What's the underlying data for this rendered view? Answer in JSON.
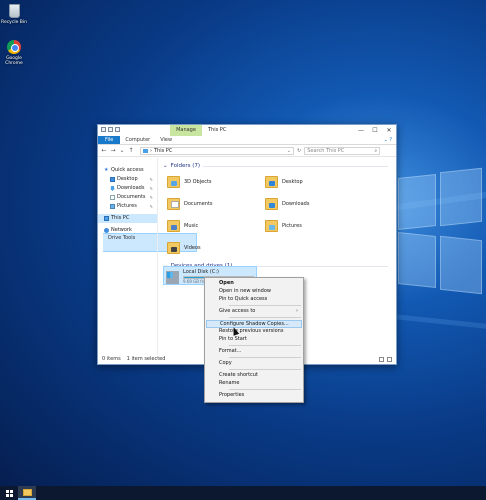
{
  "desktop": {
    "icons": [
      {
        "label": "Recycle Bin",
        "icon": "recycle-bin-icon"
      },
      {
        "label": "Google Chrome",
        "icon": "chrome-icon"
      }
    ]
  },
  "window": {
    "context_tab": "Manage",
    "title": "This PC",
    "controls": {
      "minimize": "—",
      "maximize": "☐",
      "close": "✕"
    },
    "ribbon_tabs": [
      "File",
      "Computer",
      "View",
      "Drive Tools"
    ],
    "address_path": "This PC",
    "search_placeholder": "Search This PC",
    "nav_pane": [
      {
        "label": "Quick access",
        "icon": "star-icon"
      },
      {
        "label": "Desktop",
        "icon": "desktop-folder-icon"
      },
      {
        "label": "Downloads",
        "icon": "downloads-icon"
      },
      {
        "label": "Documents",
        "icon": "documents-icon"
      },
      {
        "label": "Pictures",
        "icon": "pictures-icon"
      },
      {
        "label": "This PC",
        "icon": "this-pc-icon"
      },
      {
        "label": "Network",
        "icon": "network-icon"
      }
    ],
    "folders_header": "Folders (7)",
    "folders": [
      "3D Objects",
      "Desktop",
      "Documents",
      "Downloads",
      "Music",
      "Pictures",
      "Videos"
    ],
    "devices_header": "Devices and drives (1)",
    "drive": {
      "name": "Local Disk (C:)",
      "space": "9.69 GB fre",
      "used_fraction": 0.6
    },
    "status": {
      "items": "0 items",
      "selected": "1 item selected"
    }
  },
  "context_menu": {
    "items": [
      "Open",
      "Open in new window",
      "Pin to Quick access",
      "Give access to",
      "Configure Shadow Copies...",
      "Restore previous versions",
      "Pin to Start",
      "Format...",
      "Copy",
      "Create shortcut",
      "Rename",
      "Properties"
    ]
  },
  "taskbar": {
    "start_icon": "windows-start-icon",
    "pinned": [
      "file-explorer-icon"
    ]
  }
}
